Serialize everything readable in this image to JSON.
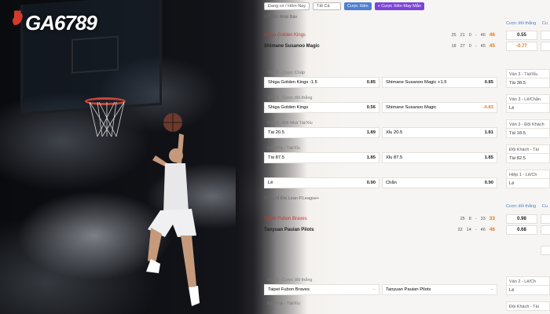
{
  "brand": {
    "logo_text": "GA6789"
  },
  "topbar": {
    "filter_day": "Đang có / Hôm Nay",
    "filter_all": "Tất Cả",
    "btn_parlay": "Cược Xiên",
    "btn_lucky_parlay": "+ Cược Xiên May Mắn"
  },
  "league1": {
    "header": "Giải B1 Nhật Bản",
    "col_handicap": "Cược đối thắng",
    "col_handicap_short": "Cu",
    "home_team": "Shiga Golden Kings",
    "away_team": "Shimane Susanoo Magic",
    "home_scores": [
      "25",
      "21",
      "0",
      "-",
      "46"
    ],
    "away_scores": [
      "18",
      "27",
      "0",
      "-",
      "45"
    ],
    "home_total": "46",
    "away_total": "45",
    "odd_home": "0.55",
    "odd_away": "-0.77"
  },
  "markets": [
    {
      "title": "Ván 3 - Cược Chấp",
      "left_label": "Shiga Golden Kings -1.5",
      "left_price": "0.85",
      "right_label": "Shimane Susanoo Magic +1.5",
      "right_price": "0.85",
      "side_title": "Ván 3 - Tài/Xỉu",
      "side_value": "Tài 38.5"
    },
    {
      "title": "Ván 3 - Cược đối thắng",
      "left_label": "Shiga Golden Kings",
      "left_price": "0.56",
      "right_label": "Shimane Susanoo Magic",
      "right_price": "-0.83",
      "side_title": "Ván 3 - Lẻ/Chẵn",
      "side_value": "Lẻ"
    },
    {
      "title": "Ván 3 - Đội Nhà Tài/Xỉu",
      "left_label": "Tài 20.5",
      "left_price": "1.89",
      "right_label": "Xỉu 20.5",
      "right_price": "1.81",
      "side_title": "Ván 3 - Đội Khách",
      "side_value": "Tài 18.5"
    },
    {
      "title": "Đội Nhà - Tài/Xỉu",
      "left_label": "Tài 87.5",
      "left_price": "1.85",
      "right_label": "Xỉu 87.5",
      "right_price": "1.85",
      "side_title": "Đội Khách - Tài",
      "side_value": "Tài 82.5"
    },
    {
      "title": "",
      "left_label": "Lẻ",
      "left_price": "0.90",
      "right_label": "Chẵn",
      "right_price": "0.90",
      "side_title": "Hiệp 1 - Lẻ/Ch",
      "side_value": "Lẻ"
    }
  ],
  "league2": {
    "header": "Bóng rổ Đài Loan P.League+",
    "col_handicap": "Cược đối thắng",
    "col_handicap_short": "Cu",
    "home_team": "Taipei Fubon Braves",
    "away_team": "Taoyuan Pauian Pilots",
    "home_scores": [
      "25",
      "8",
      "-",
      "33"
    ],
    "away_scores": [
      "32",
      "14",
      "-",
      "46"
    ],
    "home_total": "33",
    "away_total": "46",
    "odd_home": "0.98",
    "odd_away": "0.68"
  },
  "markets2": [
    {
      "title": "Ván 2 - Cược đối thắng",
      "left_label": "Taipei Fubon Braves",
      "left_price": "--",
      "right_label": "Taoyuan Pauian Pilots",
      "right_price": "--",
      "side_title": "Ván 2 - Lẻ/Ch",
      "side_value": "Lẻ"
    },
    {
      "title": "Đội Nhà - Tài/Xỉu",
      "left_label": "",
      "left_price": "",
      "right_label": "",
      "right_price": "",
      "side_title": "Đội Khách - Tài",
      "side_value": ""
    }
  ],
  "colors": {
    "accent_blue": "#4f7fd1",
    "accent_purple": "#7a44d9",
    "odds_orange": "#e07a1e",
    "team_red": "#c23b2e"
  }
}
